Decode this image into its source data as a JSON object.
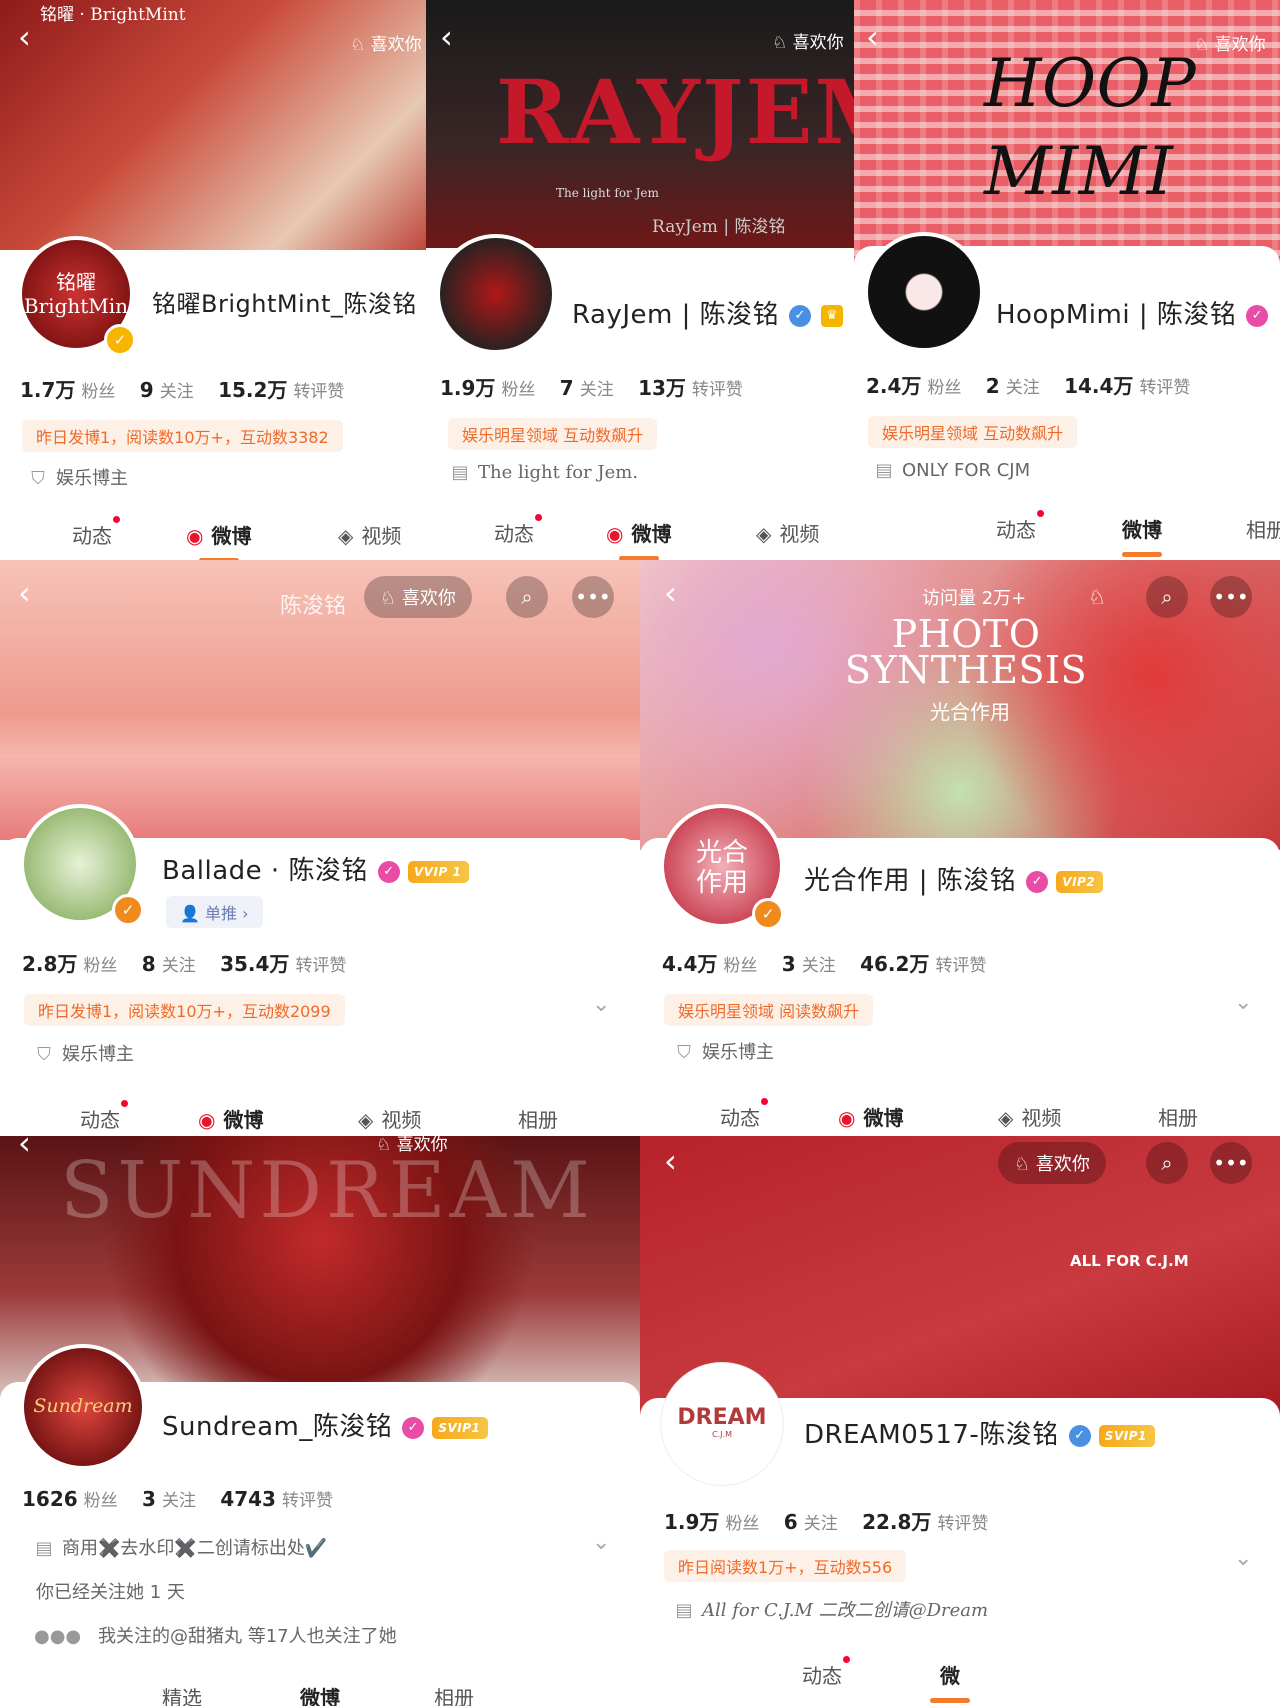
{
  "p1": {
    "banner_text": "铭曜 · BrightMint",
    "like_label": "喜欢你",
    "avatar_text": "铭曜\nBrightMin",
    "name": "铭曜BrightMint_陈浚铭",
    "fans": "1.7万",
    "fans_label": "粉丝",
    "follow": "9",
    "follow_label": "关注",
    "likes": "15.2万",
    "likes_label": "转评赞",
    "tag": "昨日发博1，阅读数10万+，互动数3382",
    "role": "娱乐博主",
    "tabs": [
      "动态",
      "微博",
      "视频"
    ]
  },
  "p2": {
    "banner_title": "RAYJEM",
    "banner_sub": "The light for Jem",
    "banner_caption": "RayJem | 陈浚铭",
    "like_label": "喜欢你",
    "name": "RayJem | 陈浚铭",
    "fans": "1.9万",
    "fans_label": "粉丝",
    "follow": "7",
    "follow_label": "关注",
    "likes": "13万",
    "likes_label": "转评赞",
    "tag": "娱乐明星领域 互动数飙升",
    "bio": "The light for Jem.",
    "tabs": [
      "动态",
      "微博",
      "视频"
    ]
  },
  "p3": {
    "banner_title": "HOOP MIMI",
    "like_label": "喜欢你",
    "name": "HoopMimi | 陈浚铭",
    "fans": "2.4万",
    "fans_label": "粉丝",
    "follow": "2",
    "follow_label": "关注",
    "likes": "14.4万",
    "likes_label": "转评赞",
    "tag": "娱乐明星领域 互动数飙升",
    "bio": "ONLY FOR CJM",
    "tabs": [
      "动态",
      "微博",
      "相册"
    ]
  },
  "p4": {
    "banner_text": "陈浚铭",
    "like_label": "喜欢你",
    "name": "Ballade · 陈浚铭",
    "vip": "VVIP 1",
    "sub_btn": "单推 ›",
    "fans": "2.8万",
    "fans_label": "粉丝",
    "follow": "8",
    "follow_label": "关注",
    "likes": "35.4万",
    "likes_label": "转评赞",
    "tag": "昨日发博1，阅读数10万+，互动数2099",
    "role": "娱乐博主",
    "tabs": [
      "动态",
      "微博",
      "视频",
      "相册"
    ]
  },
  "p5": {
    "visits": "访问量 2万+",
    "banner_title": "PHOTO SYNTHESIS",
    "banner_sub": "光合作用",
    "avatar_text": "光合\n作用",
    "name": "光合作用 | 陈浚铭",
    "vip": "VIP2",
    "fans": "4.4万",
    "fans_label": "粉丝",
    "follow": "3",
    "follow_label": "关注",
    "likes": "46.2万",
    "likes_label": "转评赞",
    "tag": "娱乐明星领域 阅读数飙升",
    "role": "娱乐博主",
    "tabs": [
      "动态",
      "微博",
      "视频",
      "相册"
    ]
  },
  "p6": {
    "banner_title": "SUNDREAM",
    "like_label": "喜欢你",
    "avatar_text": "Sundream",
    "name": "Sundream_陈浚铭",
    "vip": "SVIP1",
    "fans": "1626",
    "fans_label": "粉丝",
    "follow": "3",
    "follow_label": "关注",
    "likes": "4743",
    "likes_label": "转评赞",
    "bio": "商用✖️去水印✖️二创请标出处✔️",
    "followed_days": "你已经关注她 1 天",
    "mutual": "我关注的@甜猪丸 等17人也关注了她",
    "tabs": [
      "精选",
      "微博",
      "相册"
    ]
  },
  "p7": {
    "like_label": "喜欢你",
    "banner_text": "ALL FOR C.J.M",
    "avatar_text": "DREAM",
    "avatar_sub": "C.J.M",
    "name": "DREAM0517-陈浚铭",
    "vip": "SVIP1",
    "fans": "1.9万",
    "fans_label": "粉丝",
    "follow": "6",
    "follow_label": "关注",
    "likes": "22.8万",
    "likes_label": "转评赞",
    "tag": "昨日阅读数1万+，互动数556",
    "bio": "All for C.J.M 二改二创请@Dream",
    "tabs": [
      "动态",
      "微"
    ]
  }
}
